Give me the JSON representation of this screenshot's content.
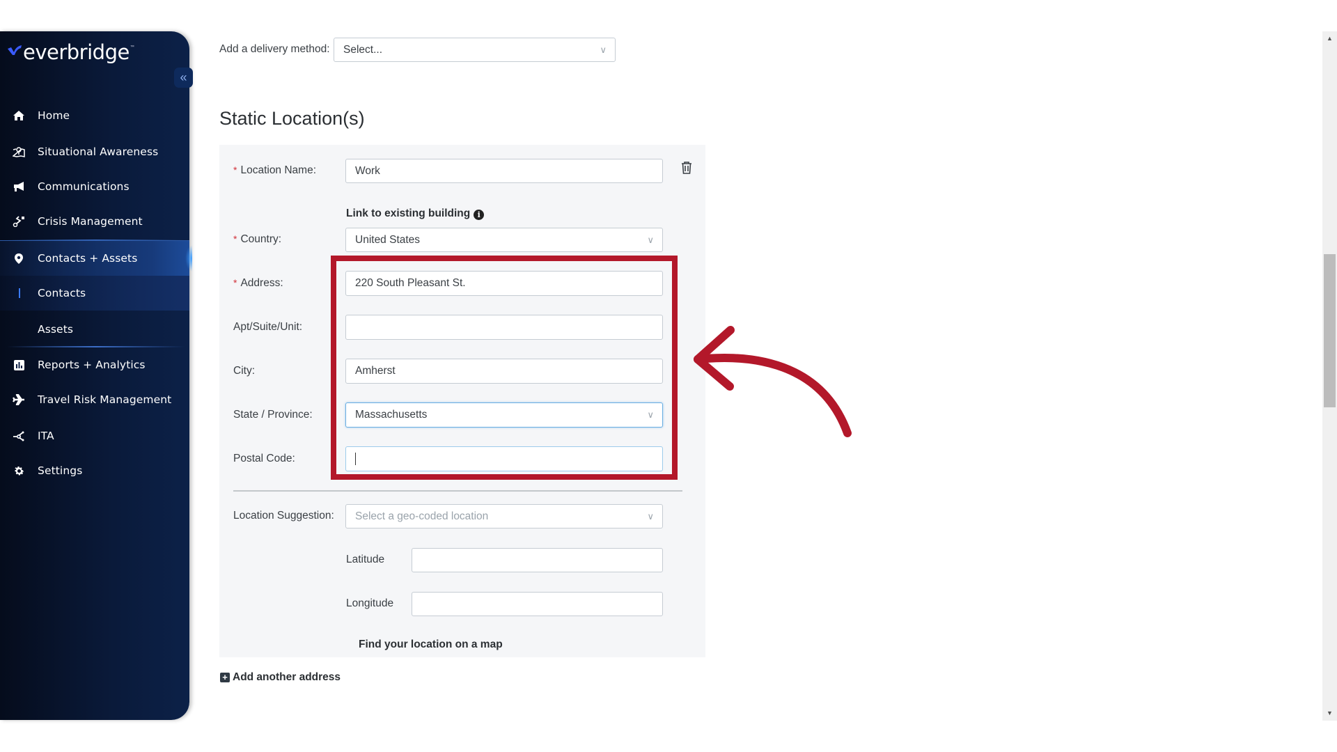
{
  "brand": {
    "name": "everbridge",
    "trademark": "™",
    "accent": "#3a5bff"
  },
  "sidebar": {
    "collapse_icon": "«",
    "items": [
      {
        "label": "Home",
        "icon": "home-icon"
      },
      {
        "label": "Situational Awareness",
        "icon": "map-pin-icon"
      },
      {
        "label": "Communications",
        "icon": "megaphone-icon"
      },
      {
        "label": "Crisis Management",
        "icon": "route-icon"
      },
      {
        "label": "Contacts + Assets",
        "icon": "location-pin-icon",
        "active": true
      },
      {
        "label": "Contacts",
        "sub": true,
        "selected": true
      },
      {
        "label": "Assets",
        "sub": true
      },
      {
        "label": "Reports + Analytics",
        "icon": "bar-chart-icon"
      },
      {
        "label": "Travel Risk Management",
        "icon": "airplane-icon"
      },
      {
        "label": "ITA",
        "icon": "network-icon"
      },
      {
        "label": "Settings",
        "icon": "gear-icon"
      }
    ]
  },
  "delivery": {
    "label": "Add a delivery method:",
    "value": "Select..."
  },
  "static_locations": {
    "title": "Static Location(s)",
    "location_name": {
      "label": "Location Name",
      "value": "Work",
      "required": true
    },
    "link_building": "Link to existing building",
    "country": {
      "label": "Country",
      "value": "United States",
      "required": true
    },
    "address": {
      "label": "Address",
      "value": "220 South Pleasant St.",
      "required": true
    },
    "apt": {
      "label": "Apt/Suite/Unit",
      "value": ""
    },
    "city": {
      "label": "City",
      "value": "Amherst"
    },
    "state": {
      "label": "State / Province",
      "value": "Massachusetts"
    },
    "postal": {
      "label": "Postal Code",
      "value": ""
    },
    "suggestion": {
      "label": "Location Suggestion",
      "placeholder": "Select a geo-coded location"
    },
    "latitude": {
      "label": "Latitude",
      "value": ""
    },
    "longitude": {
      "label": "Longitude",
      "value": ""
    },
    "find_on_map": "Find your location on a map",
    "add_another": "Add another address"
  },
  "annotation": {
    "color": "#b3182a"
  }
}
